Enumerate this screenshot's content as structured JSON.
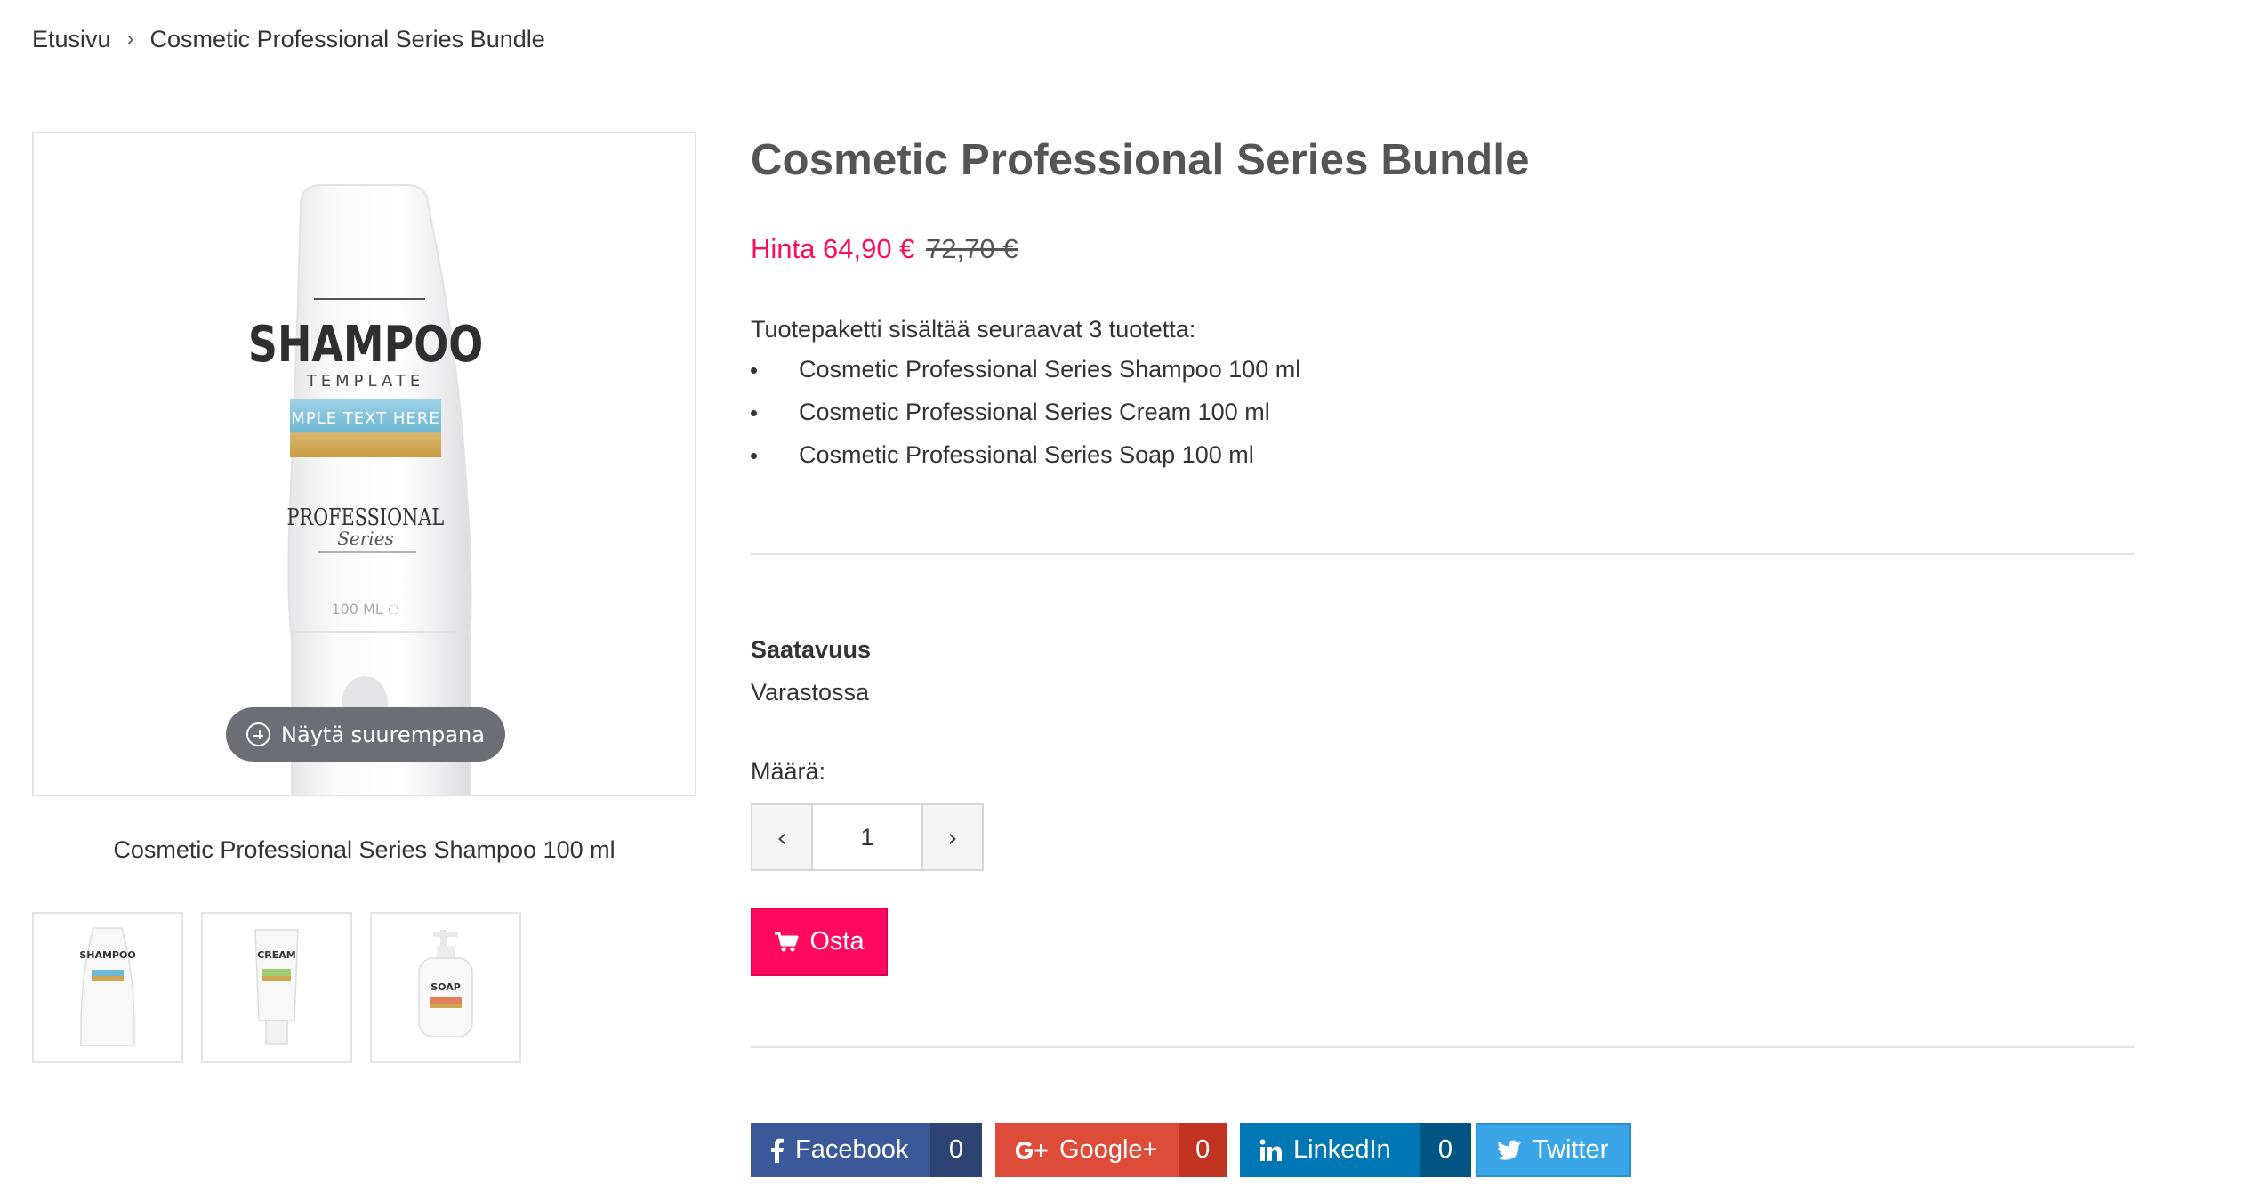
{
  "breadcrumb": {
    "home": "Etusivu",
    "separator": "›",
    "current": "Cosmetic Professional Series Bundle"
  },
  "gallery": {
    "zoom_label": "Näytä suurempana",
    "caption": "Cosmetic Professional Series Shampoo 100 ml",
    "main_product": {
      "name": "SHAMPOO",
      "sub": "TEMPLATE",
      "band_text": "MPLE TEXT HERE",
      "brand": "PROFESSIONAL",
      "brand_script": "Series",
      "volume": "100 ML ℮"
    },
    "thumbnails": [
      {
        "label": "SHAMPOO"
      },
      {
        "label": "CREAM"
      },
      {
        "label": "SOAP"
      }
    ]
  },
  "product": {
    "title": "Cosmetic Professional Series Bundle",
    "price_label": "Hinta 64,90 €",
    "old_price": "72,70 €",
    "contents_intro": "Tuotepaketti sisältää seuraavat 3 tuotetta:",
    "contents": [
      "Cosmetic Professional Series Shampoo 100 ml",
      "Cosmetic Professional Series Cream 100 ml",
      "Cosmetic Professional Series Soap 100 ml"
    ],
    "availability_label": "Saatavuus",
    "availability_value": "Varastossa",
    "quantity_label": "Määrä:",
    "quantity_value": "1",
    "buy_label": "Osta"
  },
  "social": {
    "facebook": {
      "label": "Facebook",
      "count": "0",
      "color": "#3b5998"
    },
    "googleplus": {
      "label": "Google+",
      "count": "0",
      "color": "#dd4b39"
    },
    "linkedin": {
      "label": "LinkedIn",
      "count": "0",
      "color": "#0077b5"
    },
    "twitter": {
      "label": "Twitter",
      "color": "#3aa6e8"
    }
  },
  "colors": {
    "accent": "#ff0a5f",
    "title": "#555555"
  }
}
